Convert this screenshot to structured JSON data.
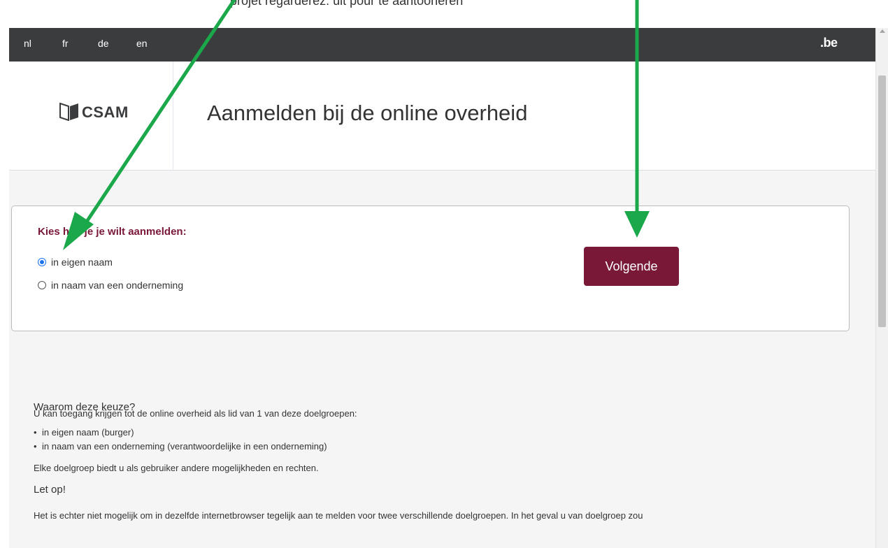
{
  "top_caption": "projet regarderez: uit pour te aantooneren",
  "language_bar": {
    "languages": [
      "nl",
      "fr",
      "de",
      "en"
    ],
    "brand": ".be"
  },
  "header": {
    "logo_text": "CSAM",
    "title": "Aanmelden bij de online overheid"
  },
  "choice_form": {
    "heading": "Kies hoe je je wilt aanmelden:",
    "options": [
      {
        "label": "in eigen naam",
        "checked": true
      },
      {
        "label": "in naam van een onderneming",
        "checked": false
      }
    ],
    "next_button": "Volgende"
  },
  "info": {
    "heading": "Waarom deze keuze?",
    "intro": "U kan toegang krijgen tot de online overheid als lid van 1 van deze doelgroepen:",
    "bullets": [
      "in eigen naam (burger)",
      "in naam van een onderneming (verantwoordelijke in een onderneming)"
    ],
    "rights": "Elke doelgroep biedt u als gebruiker andere mogelijkheden en rechten.",
    "warning_heading": "Let op!",
    "warning_text": "Het is echter niet mogelijk om in dezelfde internetbrowser tegelijk aan te melden voor twee verschillende doelgroepen. In het geval u van doelgroep zou"
  },
  "colors": {
    "accent": "#7a1838",
    "annotation_arrow": "#1aa84a",
    "language_bar": "#3b3c3e"
  }
}
